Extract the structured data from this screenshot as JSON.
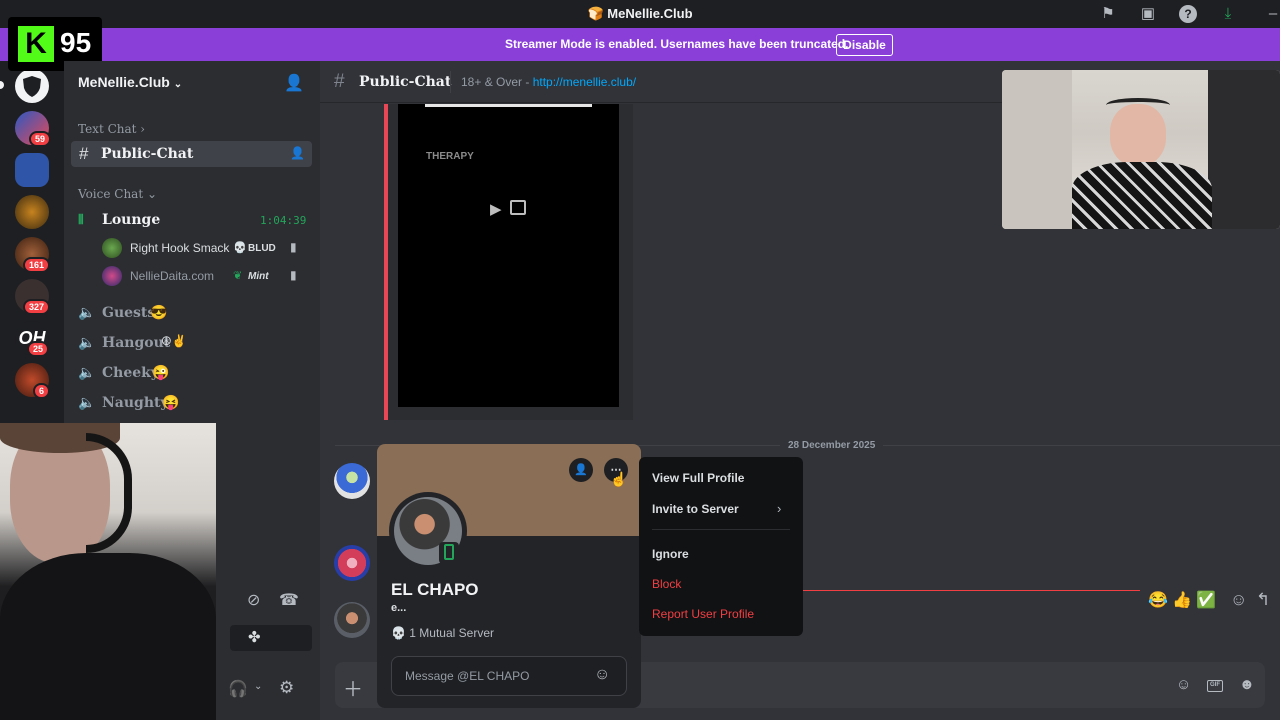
{
  "window": {
    "title": "MeNellie.Club"
  },
  "banner": {
    "text": "Streamer Mode is enabled. Usernames have been truncated.",
    "disable_label": "Disable"
  },
  "kick": {
    "logo": "K",
    "count": "95"
  },
  "servers": [
    {
      "badge": "59"
    },
    {
      "badge": ""
    },
    {
      "badge": ""
    },
    {
      "badge": "161"
    },
    {
      "badge": "327"
    },
    {
      "badge": "25"
    },
    {
      "badge": "6"
    }
  ],
  "sidebar": {
    "server_name": "MeNellie.Club",
    "text_category": "Text Chat",
    "public_chat": "Public-Chat",
    "voice_category": "Voice Chat",
    "lounge": {
      "name": "Lounge",
      "timer": "1:04:39"
    },
    "voice_users": [
      {
        "name": "Right Hook Smack",
        "tag": "BLUD"
      },
      {
        "name": "NellieDaita.com",
        "tag": "Mint"
      }
    ],
    "channels": [
      {
        "name": "Guests",
        "emoji": "😎"
      },
      {
        "name": "Hangout",
        "emoji": "☮✌"
      },
      {
        "name": "Cheeky",
        "emoji": "😜"
      },
      {
        "name": "Naughty",
        "emoji": "😝"
      }
    ]
  },
  "chat": {
    "channel": "Public-Chat",
    "topic": "18+ & Over - ",
    "topic_link": "http://menellie.club/",
    "embed_label": "THERAPY",
    "date_divider": "28 December 2025"
  },
  "popout": {
    "name": "EL CHAPO",
    "subtitle": "e...",
    "mutual": "1 Mutual Server",
    "message_placeholder": "Message @EL CHAPO"
  },
  "context_menu": {
    "view_profile": "View Full Profile",
    "invite": "Invite to Server",
    "ignore": "Ignore",
    "block": "Block",
    "report": "Report User Profile"
  },
  "reactions": [
    "😂",
    "👍",
    "✅"
  ],
  "colors": {
    "accent": "#8b3fd9",
    "kick_green": "#53fc18",
    "danger": "#f23f43",
    "online": "#23a55a",
    "link": "#00a8fc"
  }
}
